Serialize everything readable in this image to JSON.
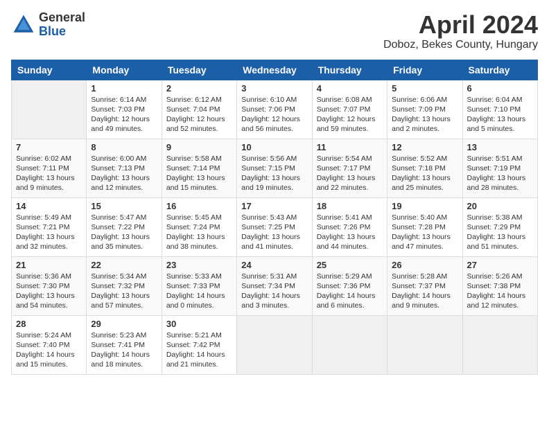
{
  "header": {
    "logo_general": "General",
    "logo_blue": "Blue",
    "month_title": "April 2024",
    "location": "Doboz, Bekes County, Hungary"
  },
  "weekdays": [
    "Sunday",
    "Monday",
    "Tuesday",
    "Wednesday",
    "Thursday",
    "Friday",
    "Saturday"
  ],
  "weeks": [
    [
      {
        "day": "",
        "sunrise": "",
        "sunset": "",
        "daylight": ""
      },
      {
        "day": "1",
        "sunrise": "Sunrise: 6:14 AM",
        "sunset": "Sunset: 7:03 PM",
        "daylight": "Daylight: 12 hours and 49 minutes."
      },
      {
        "day": "2",
        "sunrise": "Sunrise: 6:12 AM",
        "sunset": "Sunset: 7:04 PM",
        "daylight": "Daylight: 12 hours and 52 minutes."
      },
      {
        "day": "3",
        "sunrise": "Sunrise: 6:10 AM",
        "sunset": "Sunset: 7:06 PM",
        "daylight": "Daylight: 12 hours and 56 minutes."
      },
      {
        "day": "4",
        "sunrise": "Sunrise: 6:08 AM",
        "sunset": "Sunset: 7:07 PM",
        "daylight": "Daylight: 12 hours and 59 minutes."
      },
      {
        "day": "5",
        "sunrise": "Sunrise: 6:06 AM",
        "sunset": "Sunset: 7:09 PM",
        "daylight": "Daylight: 13 hours and 2 minutes."
      },
      {
        "day": "6",
        "sunrise": "Sunrise: 6:04 AM",
        "sunset": "Sunset: 7:10 PM",
        "daylight": "Daylight: 13 hours and 5 minutes."
      }
    ],
    [
      {
        "day": "7",
        "sunrise": "Sunrise: 6:02 AM",
        "sunset": "Sunset: 7:11 PM",
        "daylight": "Daylight: 13 hours and 9 minutes."
      },
      {
        "day": "8",
        "sunrise": "Sunrise: 6:00 AM",
        "sunset": "Sunset: 7:13 PM",
        "daylight": "Daylight: 13 hours and 12 minutes."
      },
      {
        "day": "9",
        "sunrise": "Sunrise: 5:58 AM",
        "sunset": "Sunset: 7:14 PM",
        "daylight": "Daylight: 13 hours and 15 minutes."
      },
      {
        "day": "10",
        "sunrise": "Sunrise: 5:56 AM",
        "sunset": "Sunset: 7:15 PM",
        "daylight": "Daylight: 13 hours and 19 minutes."
      },
      {
        "day": "11",
        "sunrise": "Sunrise: 5:54 AM",
        "sunset": "Sunset: 7:17 PM",
        "daylight": "Daylight: 13 hours and 22 minutes."
      },
      {
        "day": "12",
        "sunrise": "Sunrise: 5:52 AM",
        "sunset": "Sunset: 7:18 PM",
        "daylight": "Daylight: 13 hours and 25 minutes."
      },
      {
        "day": "13",
        "sunrise": "Sunrise: 5:51 AM",
        "sunset": "Sunset: 7:19 PM",
        "daylight": "Daylight: 13 hours and 28 minutes."
      }
    ],
    [
      {
        "day": "14",
        "sunrise": "Sunrise: 5:49 AM",
        "sunset": "Sunset: 7:21 PM",
        "daylight": "Daylight: 13 hours and 32 minutes."
      },
      {
        "day": "15",
        "sunrise": "Sunrise: 5:47 AM",
        "sunset": "Sunset: 7:22 PM",
        "daylight": "Daylight: 13 hours and 35 minutes."
      },
      {
        "day": "16",
        "sunrise": "Sunrise: 5:45 AM",
        "sunset": "Sunset: 7:24 PM",
        "daylight": "Daylight: 13 hours and 38 minutes."
      },
      {
        "day": "17",
        "sunrise": "Sunrise: 5:43 AM",
        "sunset": "Sunset: 7:25 PM",
        "daylight": "Daylight: 13 hours and 41 minutes."
      },
      {
        "day": "18",
        "sunrise": "Sunrise: 5:41 AM",
        "sunset": "Sunset: 7:26 PM",
        "daylight": "Daylight: 13 hours and 44 minutes."
      },
      {
        "day": "19",
        "sunrise": "Sunrise: 5:40 AM",
        "sunset": "Sunset: 7:28 PM",
        "daylight": "Daylight: 13 hours and 47 minutes."
      },
      {
        "day": "20",
        "sunrise": "Sunrise: 5:38 AM",
        "sunset": "Sunset: 7:29 PM",
        "daylight": "Daylight: 13 hours and 51 minutes."
      }
    ],
    [
      {
        "day": "21",
        "sunrise": "Sunrise: 5:36 AM",
        "sunset": "Sunset: 7:30 PM",
        "daylight": "Daylight: 13 hours and 54 minutes."
      },
      {
        "day": "22",
        "sunrise": "Sunrise: 5:34 AM",
        "sunset": "Sunset: 7:32 PM",
        "daylight": "Daylight: 13 hours and 57 minutes."
      },
      {
        "day": "23",
        "sunrise": "Sunrise: 5:33 AM",
        "sunset": "Sunset: 7:33 PM",
        "daylight": "Daylight: 14 hours and 0 minutes."
      },
      {
        "day": "24",
        "sunrise": "Sunrise: 5:31 AM",
        "sunset": "Sunset: 7:34 PM",
        "daylight": "Daylight: 14 hours and 3 minutes."
      },
      {
        "day": "25",
        "sunrise": "Sunrise: 5:29 AM",
        "sunset": "Sunset: 7:36 PM",
        "daylight": "Daylight: 14 hours and 6 minutes."
      },
      {
        "day": "26",
        "sunrise": "Sunrise: 5:28 AM",
        "sunset": "Sunset: 7:37 PM",
        "daylight": "Daylight: 14 hours and 9 minutes."
      },
      {
        "day": "27",
        "sunrise": "Sunrise: 5:26 AM",
        "sunset": "Sunset: 7:38 PM",
        "daylight": "Daylight: 14 hours and 12 minutes."
      }
    ],
    [
      {
        "day": "28",
        "sunrise": "Sunrise: 5:24 AM",
        "sunset": "Sunset: 7:40 PM",
        "daylight": "Daylight: 14 hours and 15 minutes."
      },
      {
        "day": "29",
        "sunrise": "Sunrise: 5:23 AM",
        "sunset": "Sunset: 7:41 PM",
        "daylight": "Daylight: 14 hours and 18 minutes."
      },
      {
        "day": "30",
        "sunrise": "Sunrise: 5:21 AM",
        "sunset": "Sunset: 7:42 PM",
        "daylight": "Daylight: 14 hours and 21 minutes."
      },
      {
        "day": "",
        "sunrise": "",
        "sunset": "",
        "daylight": ""
      },
      {
        "day": "",
        "sunrise": "",
        "sunset": "",
        "daylight": ""
      },
      {
        "day": "",
        "sunrise": "",
        "sunset": "",
        "daylight": ""
      },
      {
        "day": "",
        "sunrise": "",
        "sunset": "",
        "daylight": ""
      }
    ]
  ]
}
